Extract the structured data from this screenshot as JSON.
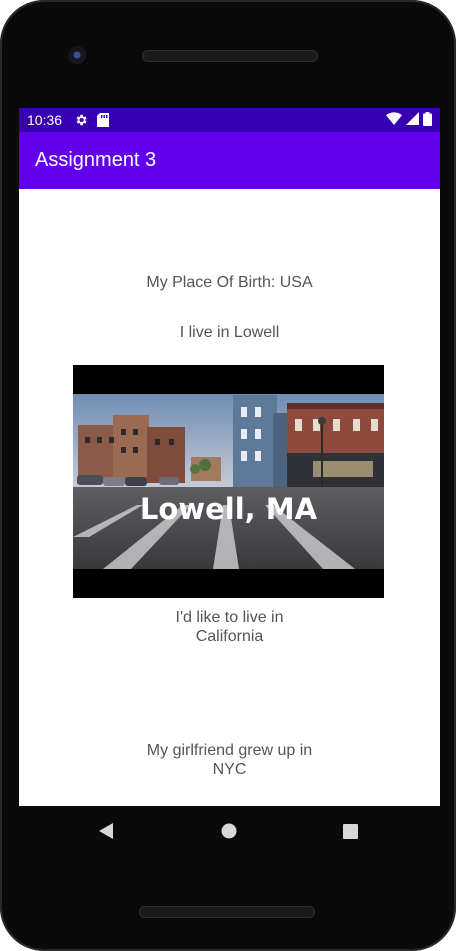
{
  "status_bar": {
    "time": "10:36",
    "icons_left": [
      "gear-icon",
      "sd-card-icon"
    ],
    "icons_right": [
      "wifi-icon",
      "cell-signal-icon",
      "battery-icon"
    ]
  },
  "app_bar": {
    "title": "Assignment 3"
  },
  "content": {
    "place_of_birth": "My Place Of Birth: USA",
    "live_in": "I live in Lowell",
    "image_caption": "Lowell, MA",
    "like_to_live_line1": "I'd like to live in",
    "like_to_live_line2": "California",
    "girlfriend_line1": "My girlfriend grew up in",
    "girlfriend_line2": "NYC"
  },
  "nav_bar": {
    "buttons": [
      "back-icon",
      "home-icon",
      "recents-icon"
    ]
  },
  "colors": {
    "status_bar": "#3700b3",
    "app_bar": "#6200ee",
    "body_text": "#555555",
    "phone_frame": "#0a0a0a"
  }
}
